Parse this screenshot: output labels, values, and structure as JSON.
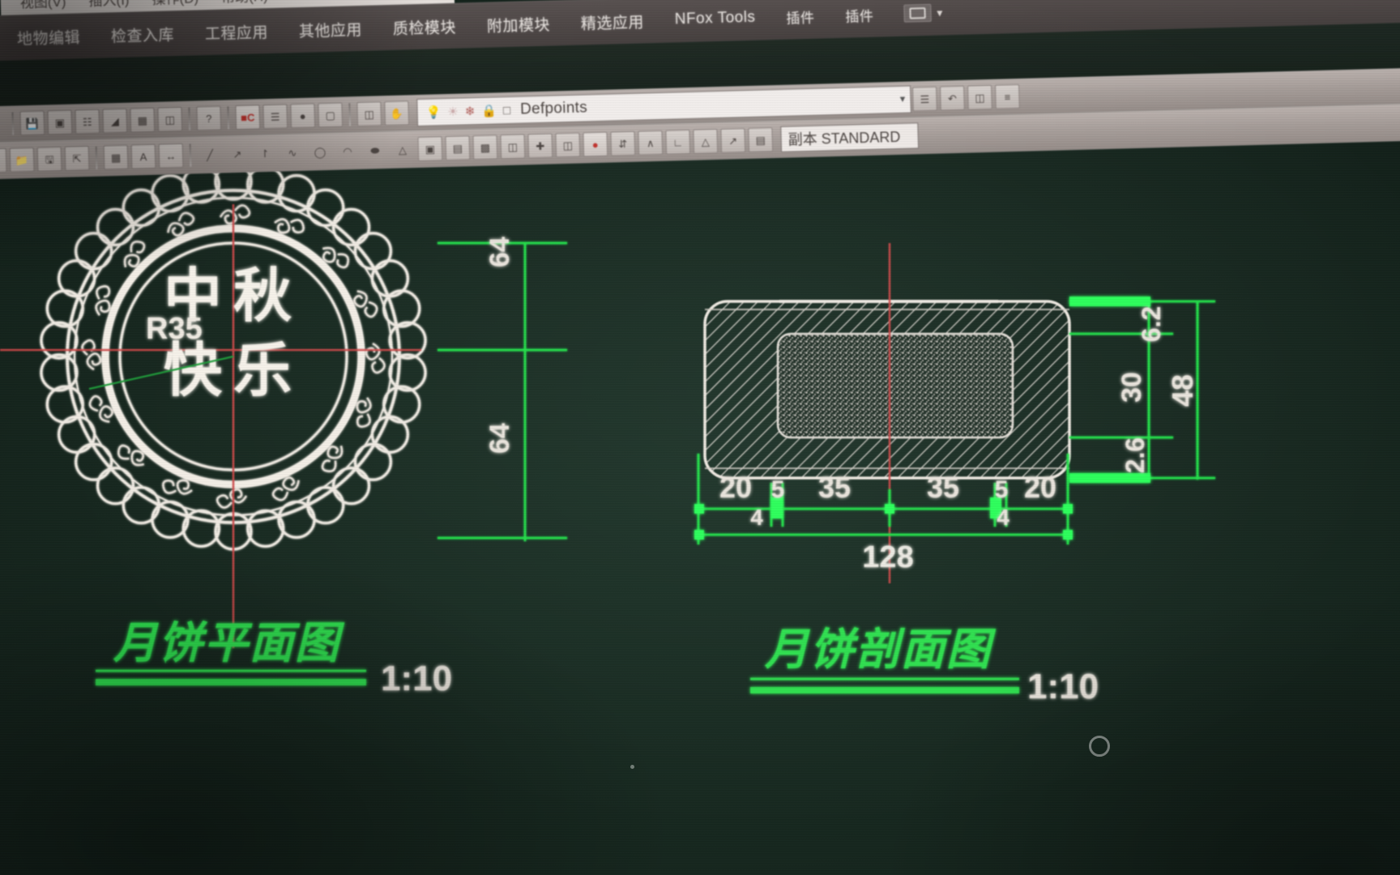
{
  "app": {
    "title_menus": [
      "视图(V)",
      "插入(I)",
      "操作(D)",
      "帮助(H)"
    ],
    "ribbon_menus": [
      "地物编辑",
      "检查入库",
      "工程应用",
      "其他应用",
      "质检模块",
      "附加模块",
      "精选应用",
      "NFox Tools",
      "插件",
      "插件"
    ],
    "overflow_icon": "overflow-menu-icon"
  },
  "toolbar": {
    "row1_icons": [
      "zoom-icon",
      "save-icon",
      "plot-preview-icon",
      "properties-icon",
      "layer-stack-icon",
      "layer-tools-icon",
      "calculator-icon",
      "help-icon",
      "bylayer-color-icon",
      "bylayer-linetype-icon",
      "bylayer-lineweight-icon",
      "bylayer-plotstyle-icon",
      "block-icon",
      "measure-icon"
    ],
    "row2_icons": [
      "new-icon",
      "open-icon",
      "save-as-icon",
      "export-icon",
      "table-icon",
      "text-style-icon",
      "dim-style-icon",
      "line-icon",
      "arc-icon",
      "polyline-icon",
      "spline-icon",
      "circle-icon",
      "arc2-icon",
      "ellipse-icon",
      "polygon-icon",
      "insert-block-icon",
      "make-block-icon",
      "hatch-icon",
      "region-icon",
      "dim-linear-icon",
      "dim-aligned-icon",
      "dim-radius-icon",
      "dim-diameter-icon",
      "dim-angular-icon",
      "dim-baseline-icon",
      "dim-continue-icon",
      "leader-icon",
      "tolerance-icon",
      "center-mark-icon"
    ],
    "layer": {
      "name": "Defpoints",
      "glyphs": [
        "lightbulb-icon",
        "sun-icon",
        "freeze-icon",
        "lock-icon",
        "plot-icon"
      ],
      "dropdown_icon": "chevron-down-icon"
    },
    "style_box": "副本 STANDARD"
  },
  "drawing": {
    "plan": {
      "title": "月饼平面图",
      "scale": "1:10",
      "stamp_text_line1": "中秋",
      "stamp_text_line2": "快乐",
      "radius_label": "R35",
      "dim_upper": "64",
      "dim_lower": "64"
    },
    "section": {
      "title": "月饼剖面图",
      "scale": "1:10",
      "horizontal_dims": [
        "20",
        "5",
        "35",
        "35",
        "5",
        "20"
      ],
      "small_dims": [
        "4",
        "4"
      ],
      "overall_width": "128",
      "vertical_dims": [
        "6.2",
        "30",
        "2.6"
      ],
      "overall_height": "48"
    }
  },
  "colors": {
    "canvas": "#16261e",
    "dimension_green": "#22e04a",
    "object_white": "#e6e6e0",
    "centerline_red": "#cf4a4a",
    "title_green": "#2ee04f"
  }
}
